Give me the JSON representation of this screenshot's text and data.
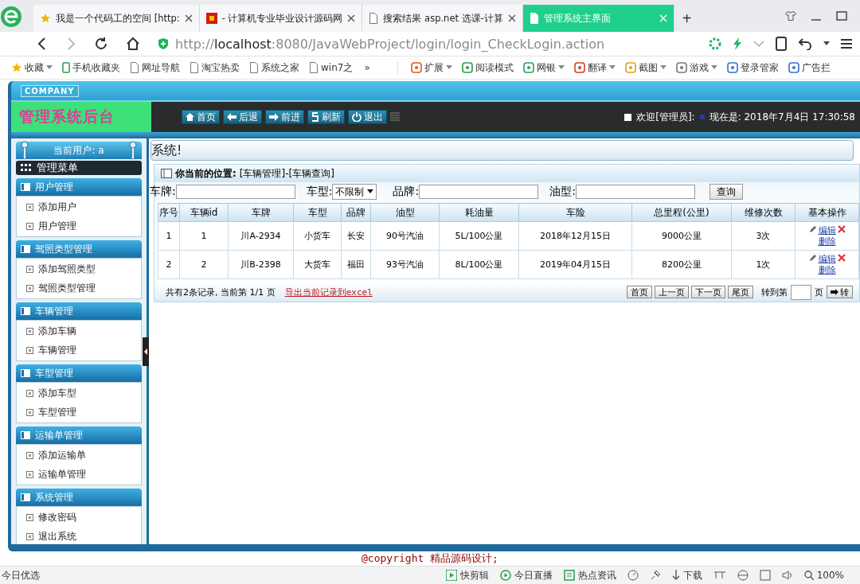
{
  "browser": {
    "tabs": [
      {
        "title": "我是一个代码工的空间 [http:",
        "selected": false
      },
      {
        "title": "- 计算机专业毕业设计源码网",
        "selected": false
      },
      {
        "title": "搜索结果 asp.net 选课-计算",
        "selected": false
      },
      {
        "title": "管理系统主界面",
        "selected": true
      }
    ],
    "new_tab": "+",
    "url": "http://**localhost**:8080/JavaWebProject/login/login_CheckLogin.action",
    "bookmarks": [
      {
        "label": "收藏",
        "dropdown": true
      },
      {
        "label": "手机收藏夹",
        "dropdown": false
      },
      {
        "label": "网址导航",
        "dropdown": false
      },
      {
        "label": "淘宝热卖",
        "dropdown": false
      },
      {
        "label": "系统之家",
        "dropdown": false
      },
      {
        "label": "win7之",
        "dropdown": false
      }
    ],
    "more": "»",
    "extensions": [
      {
        "label": "扩展",
        "dropdown": true
      },
      {
        "label": "阅读模式",
        "dropdown": false
      },
      {
        "label": "网银",
        "dropdown": true
      },
      {
        "label": "翻译",
        "dropdown": true
      },
      {
        "label": "截图",
        "dropdown": true
      },
      {
        "label": "游戏",
        "dropdown": true
      },
      {
        "label": "登录管家",
        "dropdown": false
      },
      {
        "label": "广告拦",
        "dropdown": false
      }
    ]
  },
  "app": {
    "logo": "COMPANY",
    "title": "管理系统后台",
    "nav": [
      "首页",
      "后退",
      "前进",
      "刷新",
      "退出"
    ],
    "welcome": "欢迎[管理员]:",
    "now": "现在是: 2018年7月4日 17:30:58",
    "current_user": "当前用户: a",
    "menu_title": "管理菜单",
    "menu": [
      {
        "title": "用户管理",
        "items": [
          "添加用户",
          "用户管理"
        ]
      },
      {
        "title": "驾照类型管理",
        "items": [
          "添加驾照类型",
          "驾照类型管理"
        ]
      },
      {
        "title": "车辆管理",
        "items": [
          "添加车辆",
          "车辆管理"
        ]
      },
      {
        "title": "车型管理",
        "items": [
          "添加车型",
          "车型管理"
        ]
      },
      {
        "title": "运输单管理",
        "items": [
          "添加运输单",
          "运输单管理"
        ]
      },
      {
        "title": "系统管理",
        "items": [
          "修改密码",
          "退出系统"
        ]
      }
    ],
    "marquee": "系统!",
    "location_label": "你当前的位置:",
    "location": "[车辆管理]-[车辆查询]",
    "search": [
      {
        "label": "车牌:",
        "kind": "text"
      },
      {
        "label": "车型:",
        "kind": "select",
        "value": "不限制"
      },
      {
        "label": "品牌:",
        "kind": "text"
      },
      {
        "label": "油型:",
        "kind": "text"
      }
    ],
    "search_button": "查询",
    "table": {
      "columns": [
        "序号",
        "车辆id",
        "车牌",
        "车型",
        "品牌",
        "油型",
        "耗油量",
        "车险",
        "总里程(公里)",
        "维修次数",
        "基本操作"
      ],
      "rows": [
        {
          "cells": [
            "1",
            "1",
            "川A-2934",
            "小货车",
            "长安",
            "90号汽油",
            "5L/100公里",
            "2018年12月15日",
            "9000公里",
            "3次"
          ],
          "actions": [
            "编辑",
            "删除"
          ]
        },
        {
          "cells": [
            "2",
            "2",
            "川B-2398",
            "大货车",
            "福田",
            "93号汽油",
            "8L/100公里",
            "2019年04月15日",
            "8200公里",
            "1次"
          ],
          "actions": [
            "编辑",
            "删除"
          ]
        }
      ]
    },
    "pager": {
      "summary": "共有2条记录, 当前第 1/1 页",
      "export": "导出当前记录到excel",
      "buttons": [
        "首页",
        "上一页",
        "下一页",
        "尾页"
      ],
      "goto_label": "转到第",
      "goto_suffix": "页",
      "go": "转"
    }
  },
  "footer": "@copyright 精品源码设计;",
  "status_bar": {
    "left": "今日优选",
    "items": [
      "快剪辑",
      "今日直播",
      "热点资讯"
    ],
    "download": "下载",
    "zoom": "100%"
  }
}
